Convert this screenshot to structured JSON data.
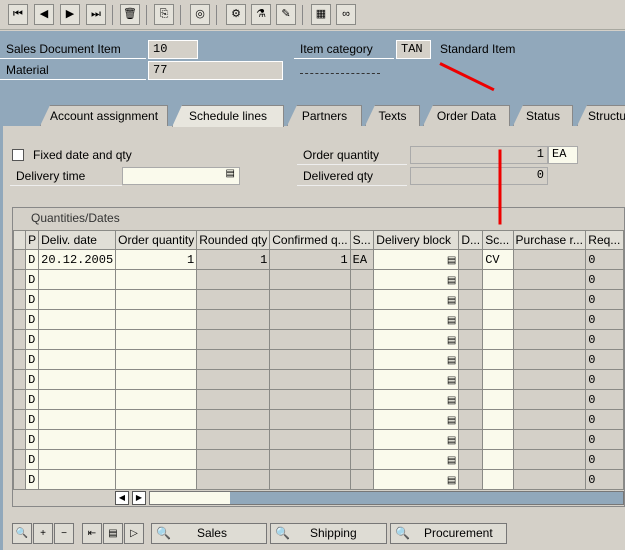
{
  "toolbar": {
    "icons": [
      "first-page-icon",
      "previous-page-icon",
      "next-page-icon",
      "last-page-icon",
      "delete-icon",
      "copy-icon",
      "display-document-icon",
      "configuration-icon",
      "test-icon",
      "edit-icon",
      "calculator-icon",
      "glasses-icon"
    ]
  },
  "header": {
    "sales_doc_item_label": "Sales Document Item",
    "sales_doc_item": "10",
    "material_label": "Material",
    "material": "77",
    "item_category_label": "Item category",
    "item_category": "TAN",
    "item_category_desc": "Standard Item"
  },
  "tabs": [
    "Account assignment",
    "Schedule lines",
    "Partners",
    "Texts",
    "Order Data",
    "Status",
    "Structu"
  ],
  "active_tab": "Schedule lines",
  "form": {
    "fixed_date_label": "Fixed date and qty",
    "delivery_time_label": "Delivery time",
    "delivery_time": "",
    "order_qty_label": "Order quantity",
    "order_qty": "1",
    "order_unit": "EA",
    "delivered_qty_label": "Delivered qty",
    "delivered_qty": "0"
  },
  "grid": {
    "title": "Quantities/Dates",
    "columns": [
      "P",
      "Deliv. date",
      "Order quantity",
      "Rounded qty",
      "Confirmed q...",
      "S...",
      "Delivery block",
      "D...",
      "Sc...",
      "Purchase r...",
      "Req..."
    ],
    "rows": [
      [
        "D",
        "20.12.2005",
        "1",
        "1",
        "1",
        "EA",
        "",
        "",
        "CV",
        "",
        "0"
      ],
      [
        "D",
        "",
        "",
        "",
        "",
        "",
        "",
        "",
        "",
        "",
        "0"
      ],
      [
        "D",
        "",
        "",
        "",
        "",
        "",
        "",
        "",
        "",
        "",
        "0"
      ],
      [
        "D",
        "",
        "",
        "",
        "",
        "",
        "",
        "",
        "",
        "",
        "0"
      ],
      [
        "D",
        "",
        "",
        "",
        "",
        "",
        "",
        "",
        "",
        "",
        "0"
      ],
      [
        "D",
        "",
        "",
        "",
        "",
        "",
        "",
        "",
        "",
        "",
        "0"
      ],
      [
        "D",
        "",
        "",
        "",
        "",
        "",
        "",
        "",
        "",
        "",
        "0"
      ],
      [
        "D",
        "",
        "",
        "",
        "",
        "",
        "",
        "",
        "",
        "",
        "0"
      ],
      [
        "D",
        "",
        "",
        "",
        "",
        "",
        "",
        "",
        "",
        "",
        "0"
      ],
      [
        "D",
        "",
        "",
        "",
        "",
        "",
        "",
        "",
        "",
        "",
        "0"
      ],
      [
        "D",
        "",
        "",
        "",
        "",
        "",
        "",
        "",
        "",
        "",
        "0"
      ],
      [
        "D",
        "",
        "",
        "",
        "",
        "",
        "",
        "",
        "",
        "",
        "0"
      ]
    ]
  },
  "buttons": {
    "sales": "Sales",
    "shipping": "Shipping",
    "procurement": "Procurement"
  },
  "colors": {
    "header_bg": "#91a8bb",
    "input_bg": "#fafaec",
    "arrow": "#e00000"
  }
}
